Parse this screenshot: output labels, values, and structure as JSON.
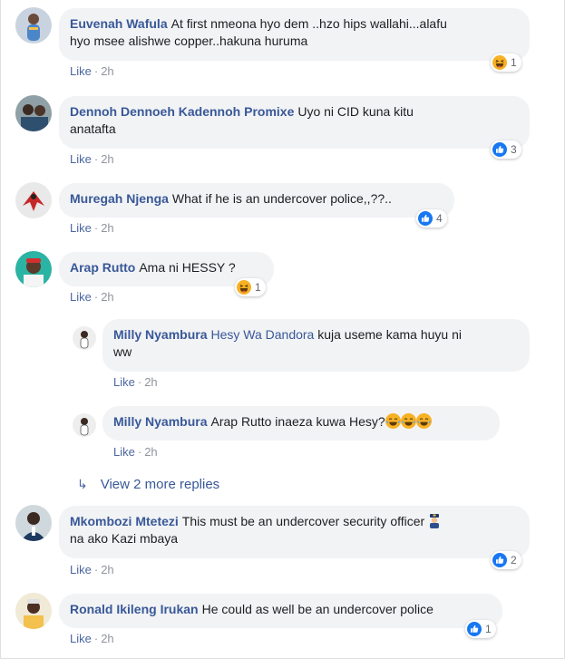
{
  "comments": [
    {
      "author": "Euvenah Wafula",
      "text_line1": "At first nmeona hyo dem ..hzo hips wallahi...alafu",
      "text_line2": "hyo msee alishwe copper..hakuna huruma",
      "like": "Like",
      "sep": "·",
      "time": "2h",
      "reaction_type": "haha",
      "reaction_count": "1"
    },
    {
      "author": "Dennoh Dennoeh Kadennoh Promixe",
      "text_line1": "Uyo ni CID kuna kitu",
      "text_line2": "anatafta",
      "like": "Like",
      "sep": "·",
      "time": "2h",
      "reaction_type": "like",
      "reaction_count": "3"
    },
    {
      "author": "Muregah Njenga",
      "text_line1": "What if he is an undercover police,,??..",
      "like": "Like",
      "sep": "·",
      "time": "2h",
      "reaction_type": "like",
      "reaction_count": "4"
    },
    {
      "author": "Arap Rutto",
      "text_line1": "Ama ni HESSY ?",
      "like": "Like",
      "sep": "·",
      "time": "2h",
      "reaction_type": "haha",
      "reaction_count": "1"
    },
    {
      "author": "Milly Nyambura",
      "mention": "Hesy Wa Dandora",
      "text_line1": "kuja useme kama huyu ni",
      "text_line2": "ww",
      "like": "Like",
      "sep": "·",
      "time": "2h"
    },
    {
      "author": "Milly Nyambura",
      "text_line1": "Arap Rutto inaeza kuwa Hesy?",
      "like": "Like",
      "sep": "·",
      "time": "2h"
    },
    {
      "author": "Mkombozi Mtetezi",
      "text_line1": "This must be an undercover security officer",
      "text_line2": "na ako Kazi mbaya",
      "like": "Like",
      "sep": "·",
      "time": "2h",
      "reaction_type": "like",
      "reaction_count": "2"
    },
    {
      "author": "Ronald Ikileng Irukan",
      "text_line1": "He could as well be an undercover police",
      "like": "Like",
      "sep": "·",
      "time": "2h",
      "reaction_type": "like",
      "reaction_count": "1"
    }
  ],
  "view_more_replies": "View 2 more replies",
  "colors": {
    "link": "#385898",
    "bubble": "#f2f3f5",
    "like_blue": "#1877f2",
    "haha_yellow": "#f7b125"
  }
}
